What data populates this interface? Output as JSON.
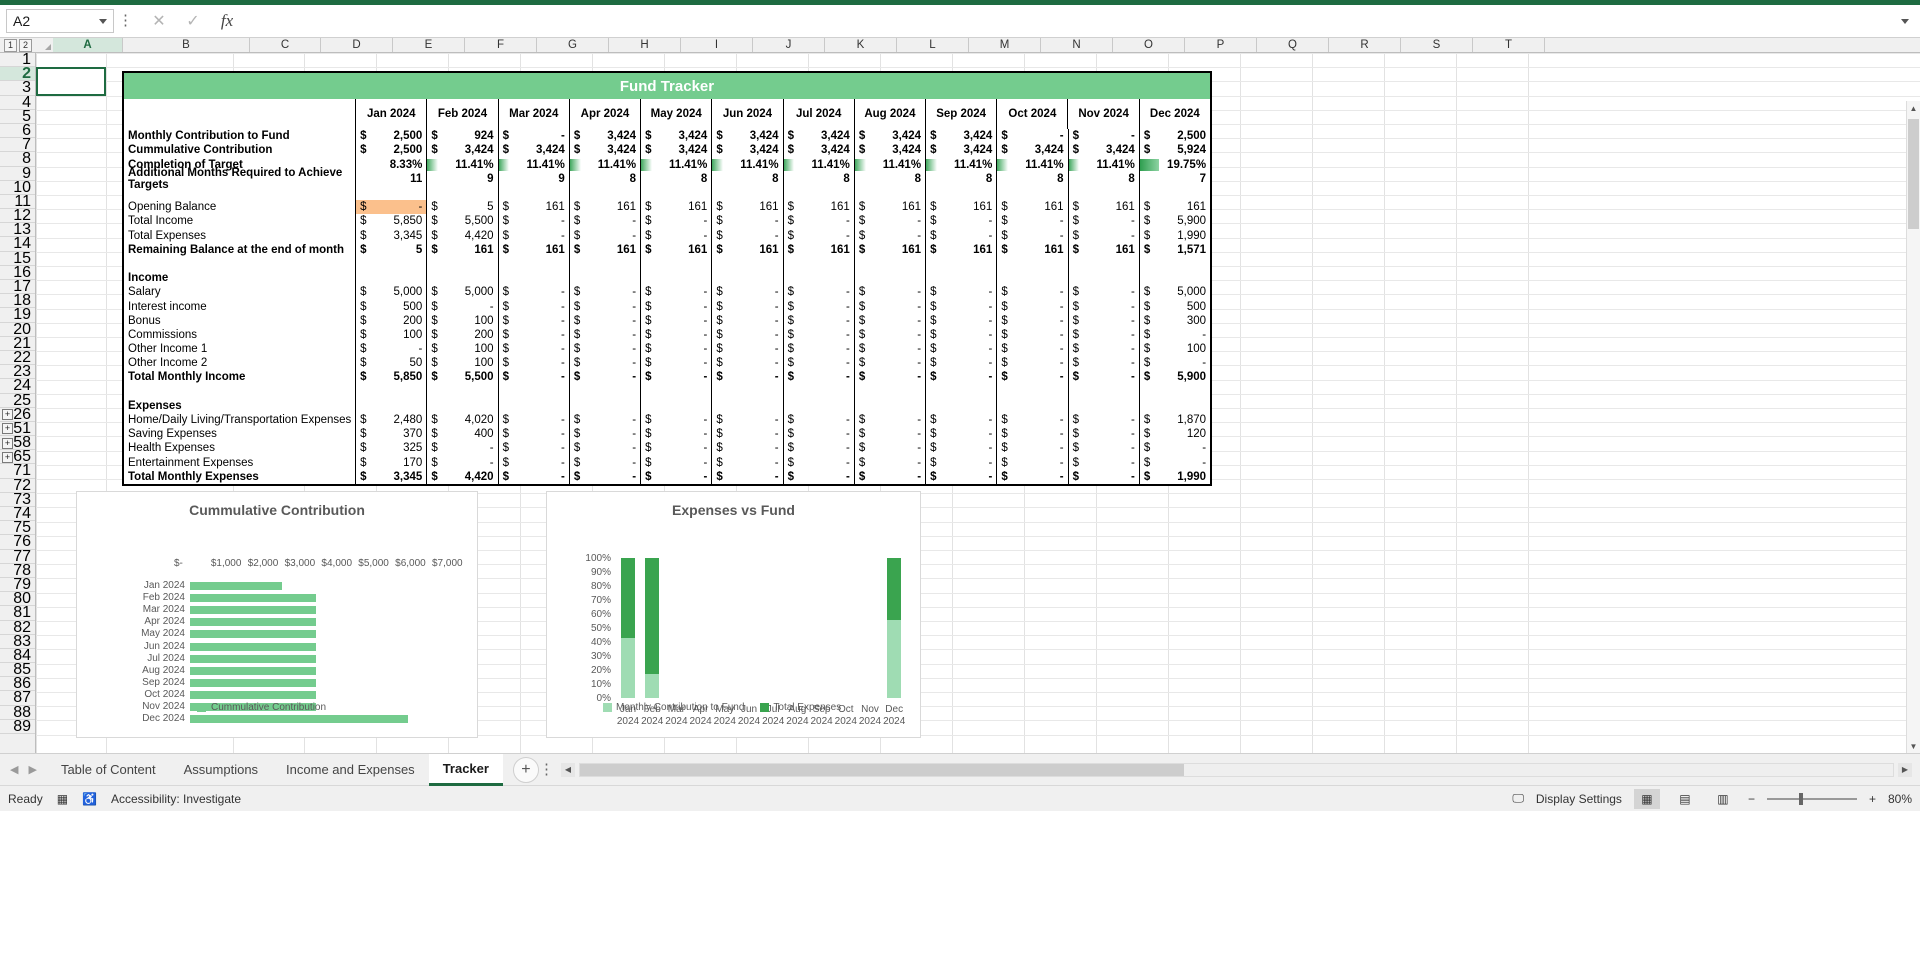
{
  "app": {
    "name_box_value": "A2",
    "formula_bar_value": "",
    "icons": {
      "name_box_dropdown": "chevron-down-icon",
      "more_options": "vertical-dots-icon",
      "cancel": "cancel-x-icon",
      "enter": "confirm-check-icon",
      "insert_function": "fx-icon",
      "formula_expand": "chevron-down-icon"
    }
  },
  "grid": {
    "outline_levels": [
      "1",
      "2"
    ],
    "columns": [
      "A",
      "B",
      "C",
      "D",
      "E",
      "F",
      "G",
      "H",
      "I",
      "J",
      "K",
      "L",
      "M",
      "N",
      "O",
      "P",
      "Q",
      "R",
      "S",
      "T"
    ],
    "selected_column": "A",
    "selected_row": "2",
    "rows": [
      "1",
      "2",
      "3",
      "4",
      "5",
      "6",
      "7",
      "8",
      "9",
      "10",
      "11",
      "12",
      "13",
      "14",
      "15",
      "16",
      "17",
      "18",
      "19",
      "20",
      "21",
      "22",
      "23",
      "24",
      "25",
      "26",
      "51",
      "58",
      "65",
      "71",
      "72",
      "73",
      "74",
      "75",
      "76",
      "77",
      "78",
      "79",
      "80",
      "81",
      "82",
      "83",
      "84",
      "85",
      "86",
      "87",
      "88",
      "89"
    ],
    "group_toggle_rows": [
      "26",
      "51",
      "58",
      "65"
    ],
    "group_toggle_label": "+"
  },
  "tracker": {
    "title": "Fund Tracker",
    "title_color": "#74cc8e",
    "months": [
      "Jan 2024",
      "Feb 2024",
      "Mar 2024",
      "Apr 2024",
      "May 2024",
      "Jun 2024",
      "Jul 2024",
      "Aug 2024",
      "Sep 2024",
      "Oct 2024",
      "Nov 2024",
      "Dec 2024"
    ],
    "summary_rows": [
      {
        "label": "Monthly Contribution to Fund",
        "bold": true,
        "currency": true,
        "values": [
          "2,500",
          "924",
          "-",
          "3,424",
          "3,424",
          "3,424",
          "3,424",
          "3,424",
          "3,424",
          "-",
          "-",
          "2,500"
        ]
      },
      {
        "label": "Cummulative Contribution",
        "bold": true,
        "currency": true,
        "values": [
          "2,500",
          "3,424",
          "3,424",
          "3,424",
          "3,424",
          "3,424",
          "3,424",
          "3,424",
          "3,424",
          "3,424",
          "3,424",
          "5,924"
        ]
      },
      {
        "label": "Completion of Target",
        "bold": true,
        "currency": false,
        "databar": true,
        "values": [
          "8.33%",
          "11.41%",
          "11.41%",
          "11.41%",
          "11.41%",
          "11.41%",
          "11.41%",
          "11.41%",
          "11.41%",
          "11.41%",
          "11.41%",
          "19.75%"
        ],
        "bar_pct": [
          0,
          36,
          36,
          36,
          36,
          36,
          36,
          36,
          36,
          36,
          36,
          64
        ]
      },
      {
        "label": "Additional Months Required to Achieve Targets",
        "bold": true,
        "currency": false,
        "values": [
          "11",
          "9",
          "9",
          "8",
          "8",
          "8",
          "8",
          "8",
          "8",
          "8",
          "8",
          "7"
        ]
      }
    ],
    "balance_rows": [
      {
        "label": "Opening Balance",
        "bold": false,
        "currency": true,
        "highlight_first": true,
        "values": [
          "-",
          "5",
          "161",
          "161",
          "161",
          "161",
          "161",
          "161",
          "161",
          "161",
          "161",
          "161"
        ]
      },
      {
        "label": "Total Income",
        "bold": false,
        "currency": true,
        "values": [
          "5,850",
          "5,500",
          "-",
          "-",
          "-",
          "-",
          "-",
          "-",
          "-",
          "-",
          "-",
          "5,900"
        ]
      },
      {
        "label": "Total Expenses",
        "bold": false,
        "currency": true,
        "values": [
          "3,345",
          "4,420",
          "-",
          "-",
          "-",
          "-",
          "-",
          "-",
          "-",
          "-",
          "-",
          "1,990"
        ]
      },
      {
        "label": "Remaining Balance at the end of month",
        "bold": true,
        "currency": true,
        "values": [
          "5",
          "161",
          "161",
          "161",
          "161",
          "161",
          "161",
          "161",
          "161",
          "161",
          "161",
          "1,571"
        ]
      }
    ],
    "income_header": "Income",
    "income_rows": [
      {
        "label": "Salary",
        "bold": false,
        "currency": true,
        "values": [
          "5,000",
          "5,000",
          "-",
          "-",
          "-",
          "-",
          "-",
          "-",
          "-",
          "-",
          "-",
          "5,000"
        ]
      },
      {
        "label": "Interest income",
        "bold": false,
        "currency": true,
        "values": [
          "500",
          "-",
          "-",
          "-",
          "-",
          "-",
          "-",
          "-",
          "-",
          "-",
          "-",
          "500"
        ]
      },
      {
        "label": "Bonus",
        "bold": false,
        "currency": true,
        "values": [
          "200",
          "100",
          "-",
          "-",
          "-",
          "-",
          "-",
          "-",
          "-",
          "-",
          "-",
          "300"
        ]
      },
      {
        "label": "Commissions",
        "bold": false,
        "currency": true,
        "values": [
          "100",
          "200",
          "-",
          "-",
          "-",
          "-",
          "-",
          "-",
          "-",
          "-",
          "-",
          "-"
        ]
      },
      {
        "label": "Other Income 1",
        "bold": false,
        "currency": true,
        "values": [
          "-",
          "100",
          "-",
          "-",
          "-",
          "-",
          "-",
          "-",
          "-",
          "-",
          "-",
          "100"
        ]
      },
      {
        "label": "Other Income 2",
        "bold": false,
        "currency": true,
        "values": [
          "50",
          "100",
          "-",
          "-",
          "-",
          "-",
          "-",
          "-",
          "-",
          "-",
          "-",
          "-"
        ]
      },
      {
        "label": "Total Monthly Income",
        "bold": true,
        "currency": true,
        "values": [
          "5,850",
          "5,500",
          "-",
          "-",
          "-",
          "-",
          "-",
          "-",
          "-",
          "-",
          "-",
          "5,900"
        ]
      }
    ],
    "expenses_header": "Expenses",
    "expense_rows": [
      {
        "label": "Home/Daily Living/Transportation Expenses",
        "bold": false,
        "currency": true,
        "values": [
          "2,480",
          "4,020",
          "-",
          "-",
          "-",
          "-",
          "-",
          "-",
          "-",
          "-",
          "-",
          "1,870"
        ]
      },
      {
        "label": "Saving Expenses",
        "bold": false,
        "currency": true,
        "values": [
          "370",
          "400",
          "-",
          "-",
          "-",
          "-",
          "-",
          "-",
          "-",
          "-",
          "-",
          "120"
        ]
      },
      {
        "label": "Health Expenses",
        "bold": false,
        "currency": true,
        "values": [
          "325",
          "-",
          "-",
          "-",
          "-",
          "-",
          "-",
          "-",
          "-",
          "-",
          "-",
          "-"
        ]
      },
      {
        "label": "Entertainment Expenses",
        "bold": false,
        "currency": true,
        "values": [
          "170",
          "-",
          "-",
          "-",
          "-",
          "-",
          "-",
          "-",
          "-",
          "-",
          "-",
          "-"
        ]
      },
      {
        "label": "Total Monthly Expenses",
        "bold": true,
        "currency": true,
        "values": [
          "3,345",
          "4,420",
          "-",
          "-",
          "-",
          "-",
          "-",
          "-",
          "-",
          "-",
          "-",
          "1,990"
        ]
      }
    ]
  },
  "chart_data": [
    {
      "type": "bar",
      "title": "Cummulative Contribution",
      "orientation": "horizontal",
      "categories": [
        "Jan 2024",
        "Feb 2024",
        "Mar 2024",
        "Apr 2024",
        "May 2024",
        "Jun 2024",
        "Jul 2024",
        "Aug 2024",
        "Sep 2024",
        "Oct 2024",
        "Nov 2024",
        "Dec 2024"
      ],
      "values": [
        2500,
        3424,
        3424,
        3424,
        3424,
        3424,
        3424,
        3424,
        3424,
        3424,
        3424,
        5924
      ],
      "tick_labels": [
        "$-",
        "$1,000",
        "$2,000",
        "$3,000",
        "$4,000",
        "$5,000",
        "$6,000",
        "$7,000"
      ],
      "xlim": [
        0,
        7000
      ],
      "xlabel": "",
      "ylabel": "",
      "legend": [
        "Cummulative Contribution"
      ],
      "legend_position": "bottom",
      "series_color": "#74cc8e",
      "grid": false
    },
    {
      "type": "bar",
      "title": "Expenses vs Fund",
      "orientation": "vertical",
      "stacked": true,
      "categories": [
        "Jan 2024",
        "Feb 2024",
        "Mar 2024",
        "Apr 2024",
        "May 2024",
        "Jun 2024",
        "Jul 2024",
        "Aug 2024",
        "Sep 2024",
        "Oct 2024",
        "Nov 2024",
        "Dec 2024"
      ],
      "tick_labels": [
        "0%",
        "10%",
        "20%",
        "30%",
        "40%",
        "50%",
        "60%",
        "70%",
        "80%",
        "90%",
        "100%"
      ],
      "ylim": [
        0,
        100
      ],
      "series": [
        {
          "name": "Monthly Contribution to Fund",
          "color": "#9fdcb3",
          "values": [
            42.7,
            17.3,
            0,
            0,
            0,
            0,
            0,
            0,
            0,
            0,
            0,
            55.7
          ]
        },
        {
          "name": "Total Expenses",
          "color": "#3aa44f",
          "values": [
            57.3,
            82.7,
            0,
            0,
            0,
            0,
            0,
            0,
            0,
            0,
            0,
            44.3
          ]
        }
      ],
      "legend": [
        "Monthly Contribution to Fund",
        "Total Expenses"
      ],
      "legend_position": "bottom",
      "grid": false
    }
  ],
  "sheet_tabs": {
    "items": [
      "Table of Content",
      "Assumptions",
      "Income and Expenses",
      "Tracker"
    ],
    "active": "Tracker",
    "add_sheet_label": "+"
  },
  "status_bar": {
    "state": "Ready",
    "accessibility": "Accessibility: Investigate",
    "display_settings": "Display Settings",
    "zoom": "80%",
    "zoom_out": "−",
    "zoom_in": "+",
    "icons": {
      "macro_record": "record-macro-icon",
      "accessibility": "accessibility-icon",
      "display_settings": "display-settings-icon",
      "normal_view": "normal-view-icon",
      "page_layout_view": "page-layout-view-icon",
      "page_break_view": "page-break-view-icon"
    }
  }
}
